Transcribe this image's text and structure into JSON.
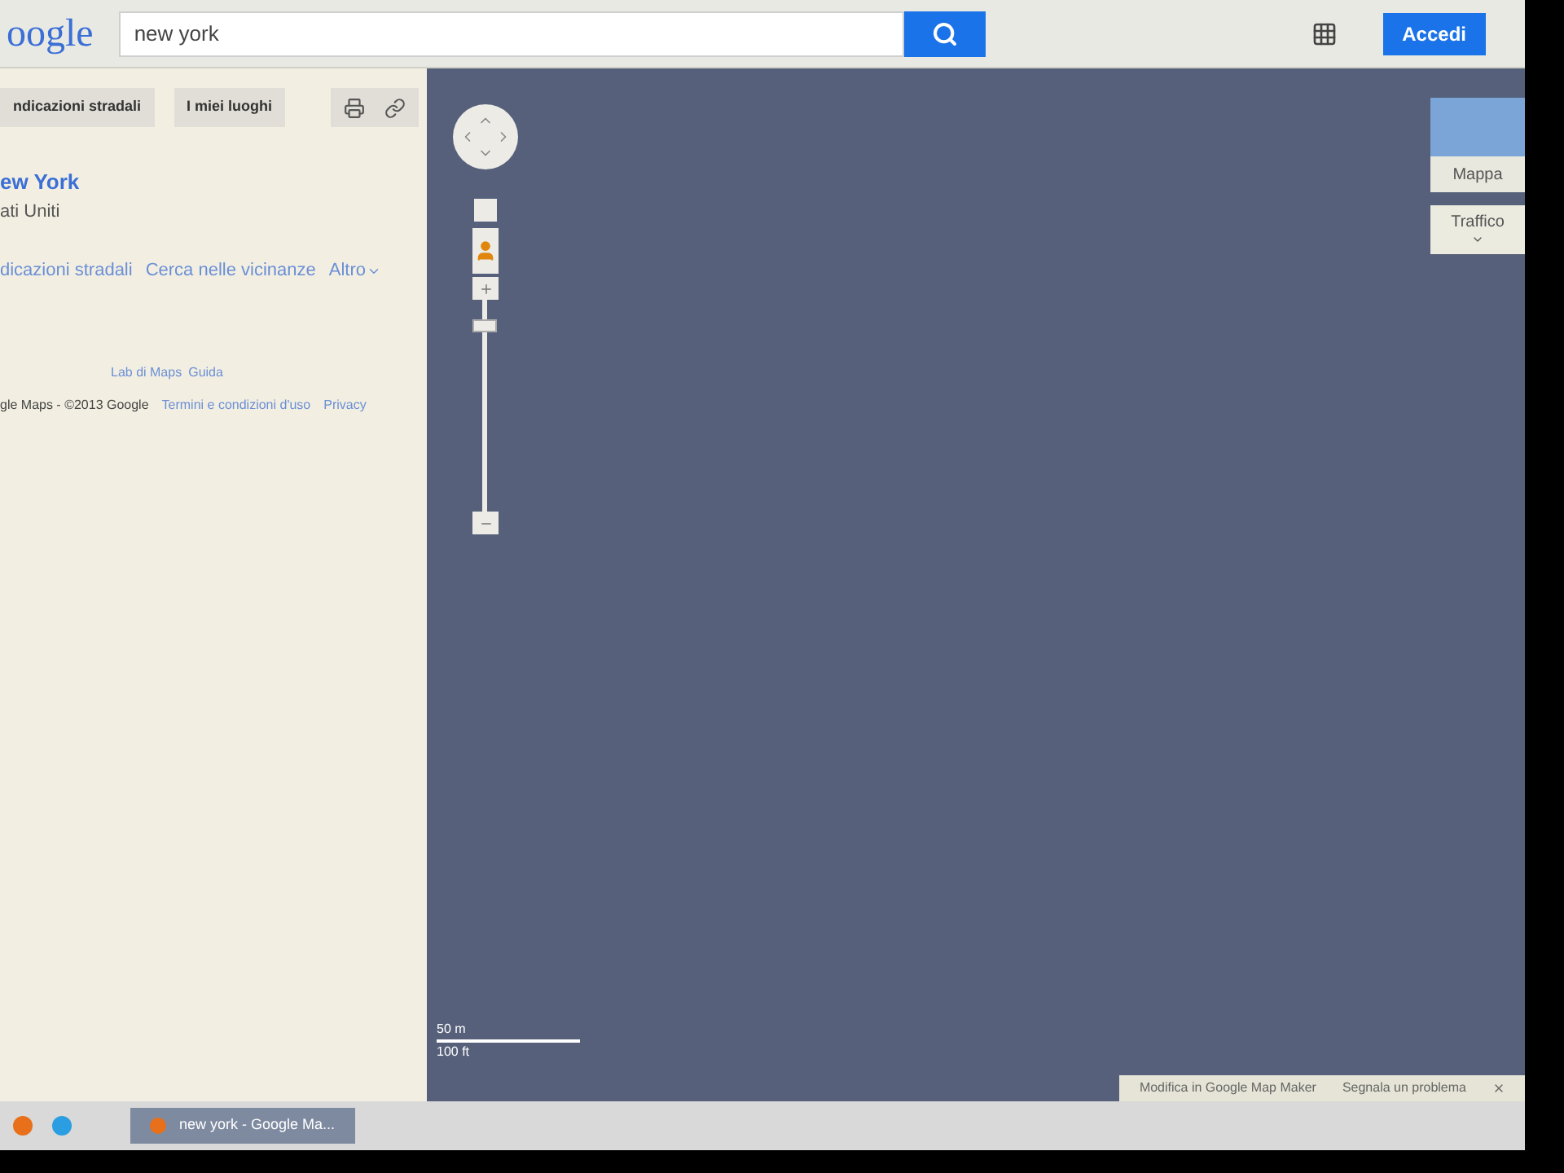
{
  "header": {
    "logo": "oogle",
    "search": {
      "value": "new york"
    },
    "signin": "Accedi"
  },
  "sidebar": {
    "buttons": [
      "ndicazioni stradali",
      "I miei luoghi"
    ],
    "place": {
      "name": "ew York",
      "country": "ati Uniti"
    },
    "actions": [
      "dicazioni stradali",
      "Cerca nelle vicinanze",
      "Altro"
    ],
    "footer_links": [
      "Lab di Maps",
      "Guida"
    ],
    "copyright": "gle Maps - ©2013 Google",
    "legal_links": [
      "Termini e condizioni d'uso",
      "Privacy"
    ]
  },
  "map": {
    "zoom": {
      "level": 0.9
    },
    "layers": [
      {
        "label": "Mappa"
      },
      {
        "label": "Traffico"
      }
    ],
    "scale": [
      "50 m",
      "100 ft"
    ],
    "footer": [
      "Modifica in Google Map Maker",
      "Segnala un problema"
    ]
  },
  "taskbar": {
    "window": "new york - Google Ma..."
  }
}
